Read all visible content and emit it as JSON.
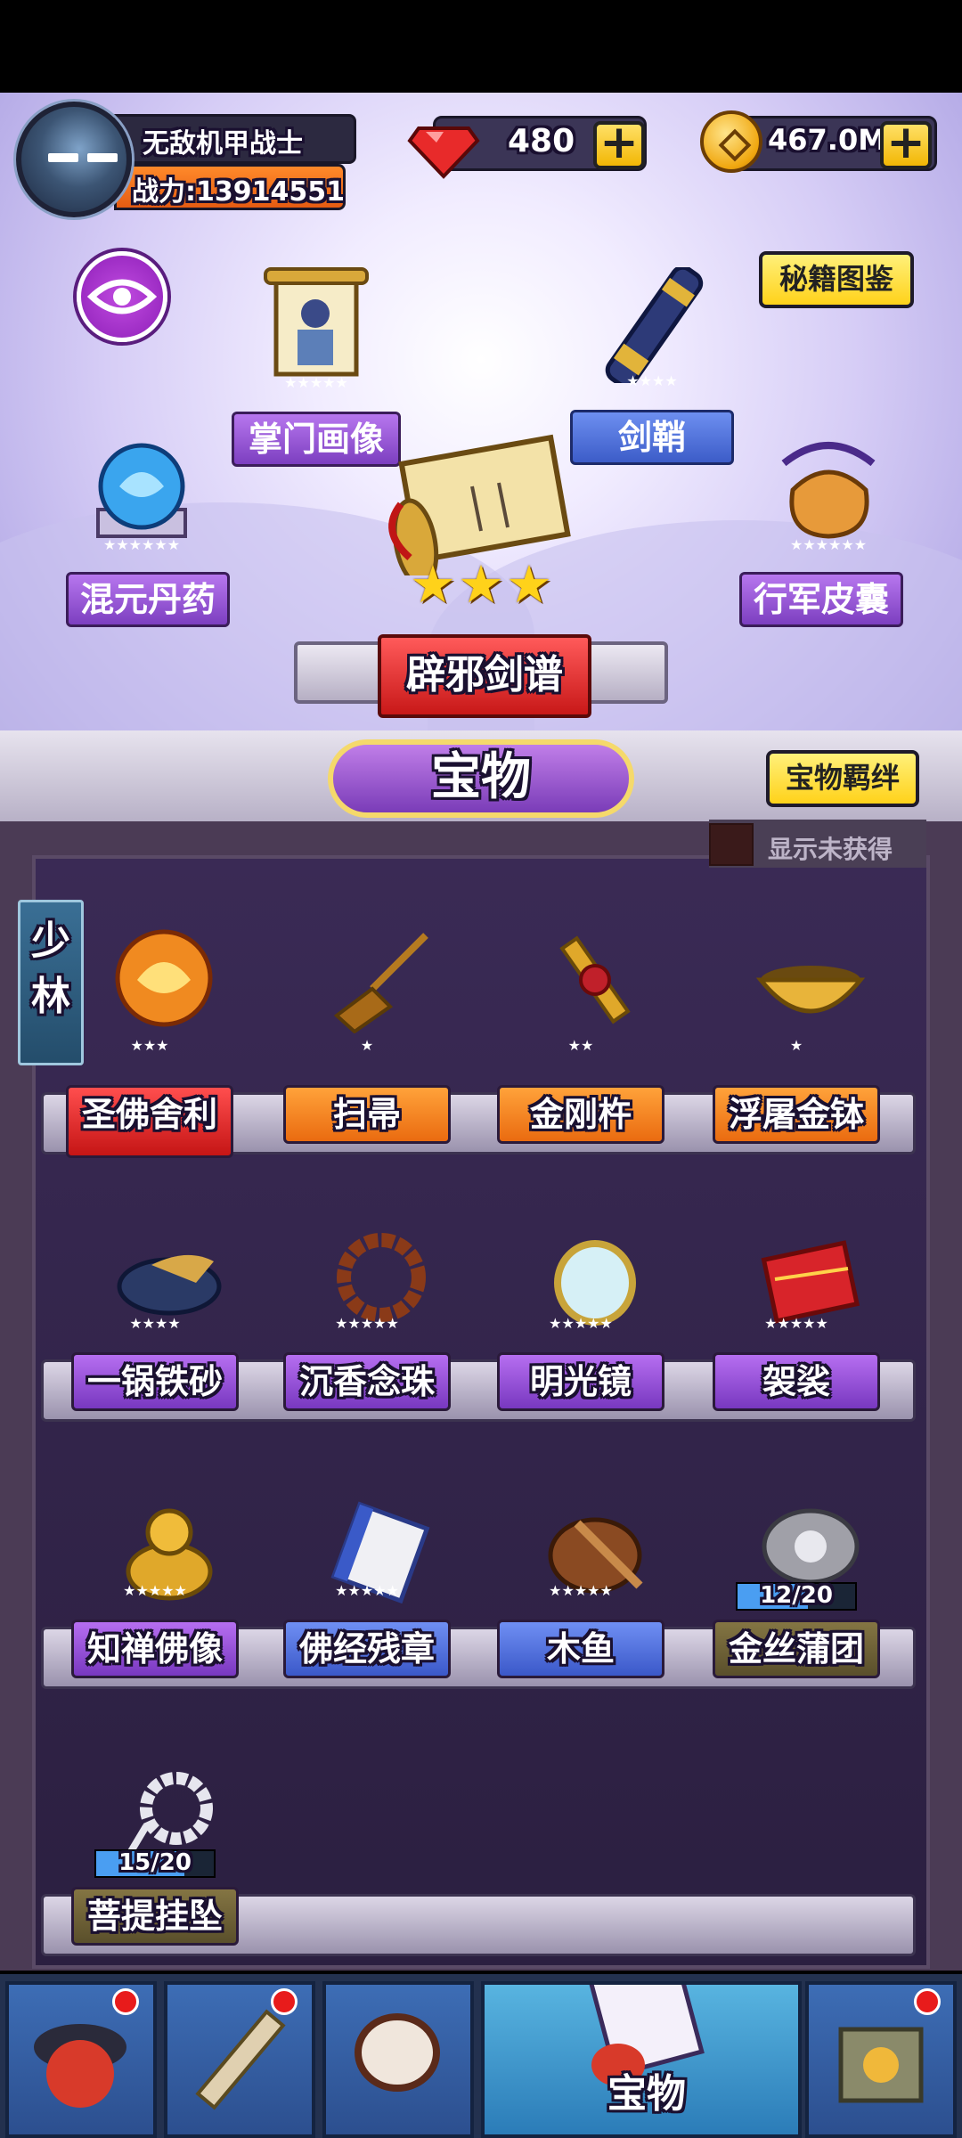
{
  "player": {
    "name": "无敌机甲战士",
    "power": "战力:13914551"
  },
  "currency": {
    "gems": "480",
    "coins": "467.0M",
    "plus": "+"
  },
  "buttons": {
    "codex": "秘籍图鉴",
    "bond": "宝物羁绊"
  },
  "featured": [
    {
      "name": "掌门画像",
      "stars": 5,
      "tag": "purple"
    },
    {
      "name": "剑鞘",
      "stars": 4,
      "tag": "blue"
    },
    {
      "name": "混元丹药",
      "stars": 6,
      "tag": "purple"
    },
    {
      "name": "辟邪剑谱",
      "stars": 3,
      "tag": "red"
    },
    {
      "name": "行军皮囊",
      "stars": 6,
      "tag": "purple"
    }
  ],
  "section_title": "宝物",
  "show_unowned": "显示未获得",
  "clan": "少林",
  "shelves": [
    [
      {
        "name": "圣佛舍利",
        "stars": 3,
        "tag": "red"
      },
      {
        "name": "扫帚",
        "stars": 1,
        "tag": "orange"
      },
      {
        "name": "金刚杵",
        "stars": 2,
        "tag": "orange"
      },
      {
        "name": "浮屠金钵",
        "stars": 1,
        "tag": "orange"
      }
    ],
    [
      {
        "name": "一锅铁砂",
        "stars": 4,
        "tag": "purple"
      },
      {
        "name": "沉香念珠",
        "stars": 5,
        "tag": "purple"
      },
      {
        "name": "明光镜",
        "stars": 5,
        "tag": "purple"
      },
      {
        "name": "袈裟",
        "stars": 5,
        "tag": "purple"
      }
    ],
    [
      {
        "name": "知禅佛像",
        "stars": 5,
        "tag": "purple"
      },
      {
        "name": "佛经残章",
        "stars": 5,
        "tag": "blue"
      },
      {
        "name": "木鱼",
        "stars": 5,
        "tag": "blue"
      },
      {
        "name": "金丝蒲团",
        "progress": "12/20",
        "tag": "olive"
      }
    ],
    [
      {
        "name": "菩提挂坠",
        "progress": "15/20",
        "tag": "olive"
      }
    ]
  ],
  "nav": {
    "active_label": "宝物"
  },
  "colors": {
    "gold": "#ffd21a",
    "purple": "#9a55d8",
    "red": "#d91f1f"
  }
}
